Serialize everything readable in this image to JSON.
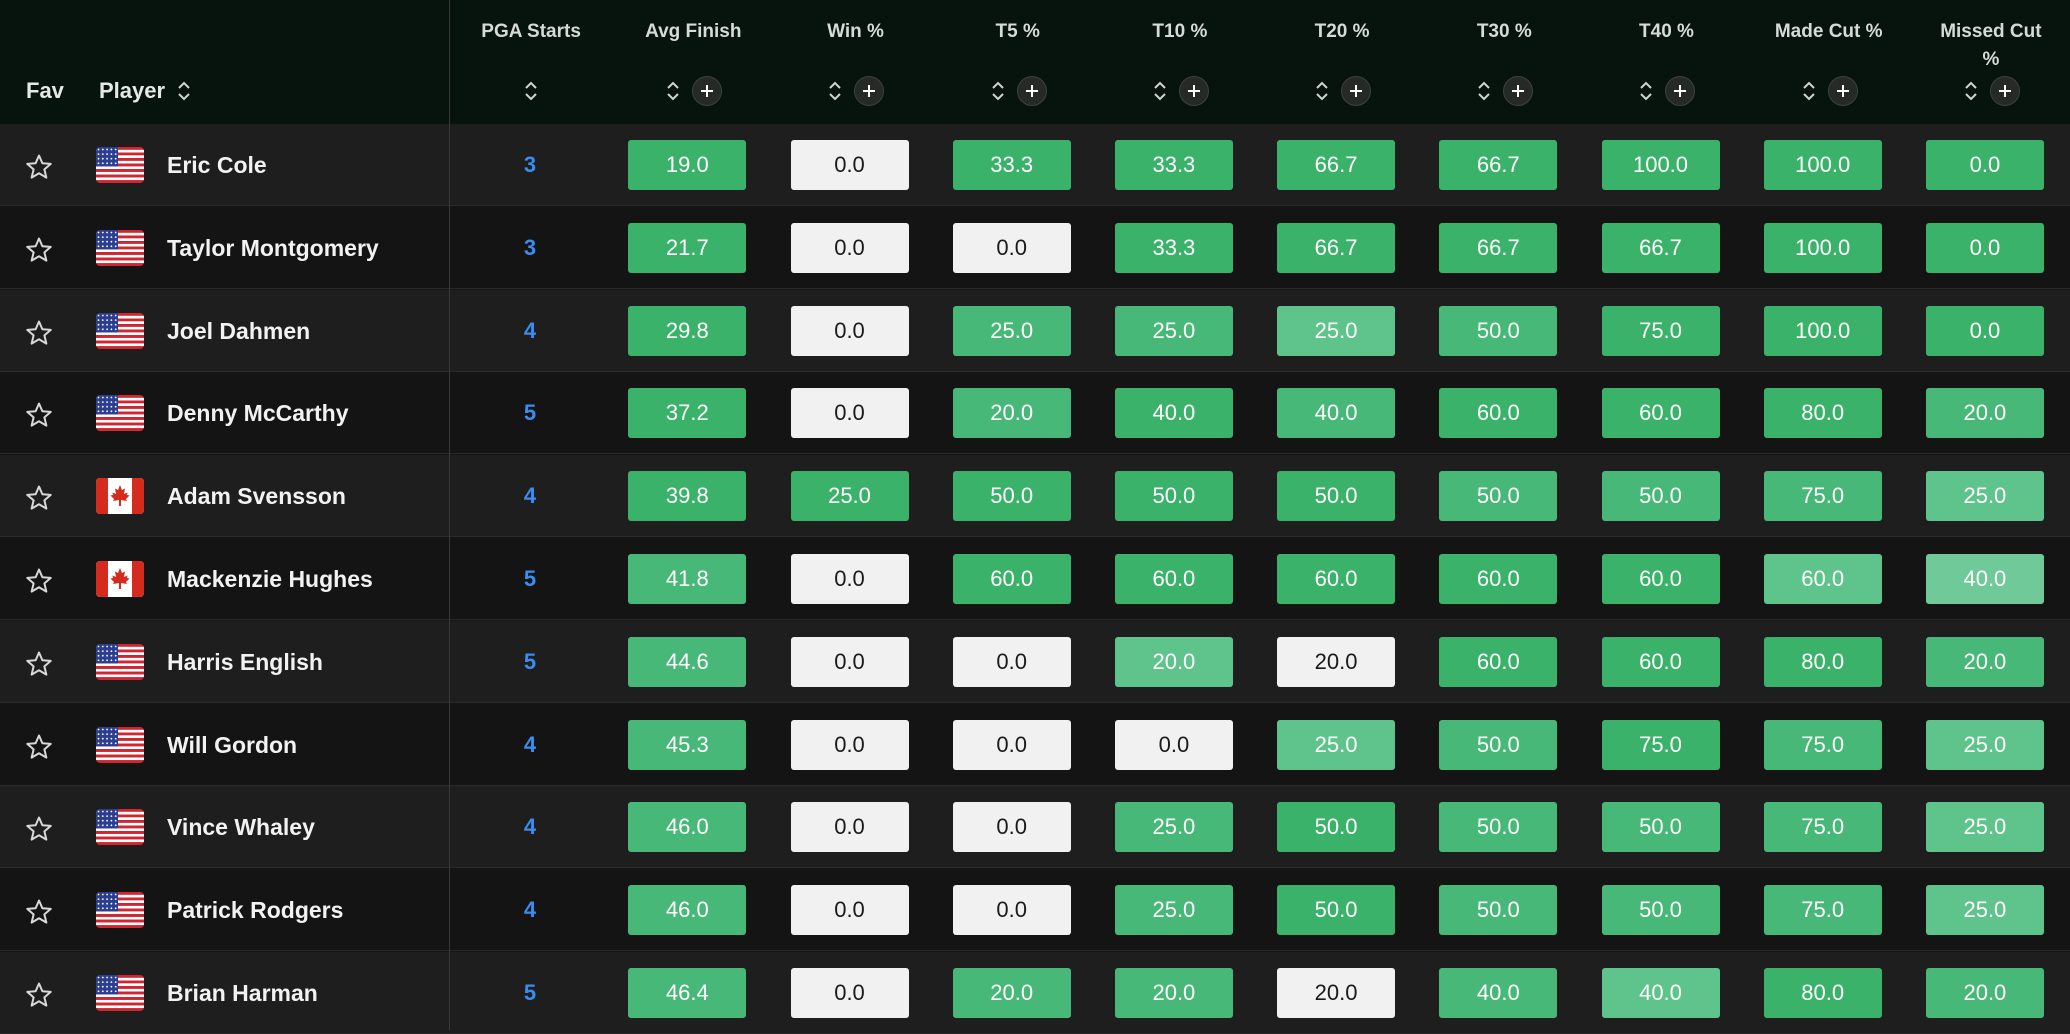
{
  "header": {
    "fav": "Fav",
    "player": "Player",
    "columns": [
      {
        "title": "PGA Starts",
        "plus": false
      },
      {
        "title": "Avg Finish",
        "plus": true
      },
      {
        "title": "Win %",
        "plus": true
      },
      {
        "title": "T5 %",
        "plus": true
      },
      {
        "title": "T10 %",
        "plus": true
      },
      {
        "title": "T20 %",
        "plus": true
      },
      {
        "title": "T30 %",
        "plus": true
      },
      {
        "title": "T40 %",
        "plus": true
      },
      {
        "title": "Made Cut %",
        "plus": true
      },
      {
        "title": "Missed Cut %",
        "plus": true
      }
    ]
  },
  "colors": {
    "header_bg": "#07140d",
    "starts_link": "#3a8df0",
    "green_strong": "#3bb26a",
    "green_mid": "#47b877",
    "green_light": "#5ec48b",
    "green_pale": "#70c998",
    "neutral_cell": "#f1f1f1"
  },
  "rows": [
    {
      "player": "Eric Cole",
      "flag": "us",
      "starts": "3",
      "stats": [
        "19.0",
        "0.0",
        "33.3",
        "33.3",
        "66.7",
        "66.7",
        "100.0",
        "100.0",
        "0.0"
      ],
      "shades": [
        "green1",
        "white",
        "green1",
        "green1",
        "green1",
        "green1",
        "green1",
        "green1",
        "green1"
      ]
    },
    {
      "player": "Taylor Montgomery",
      "flag": "us",
      "starts": "3",
      "stats": [
        "21.7",
        "0.0",
        "0.0",
        "33.3",
        "66.7",
        "66.7",
        "66.7",
        "100.0",
        "0.0"
      ],
      "shades": [
        "green1",
        "white",
        "white",
        "green1",
        "green1",
        "green1",
        "green1",
        "green1",
        "green1"
      ]
    },
    {
      "player": "Joel Dahmen",
      "flag": "us",
      "starts": "4",
      "stats": [
        "29.8",
        "0.0",
        "25.0",
        "25.0",
        "25.0",
        "50.0",
        "75.0",
        "100.0",
        "0.0"
      ],
      "shades": [
        "green1",
        "white",
        "green2",
        "green2",
        "green3",
        "green2",
        "green1",
        "green1",
        "green1"
      ]
    },
    {
      "player": "Denny McCarthy",
      "flag": "us",
      "starts": "5",
      "stats": [
        "37.2",
        "0.0",
        "20.0",
        "40.0",
        "40.0",
        "60.0",
        "60.0",
        "80.0",
        "20.0"
      ],
      "shades": [
        "green1",
        "white",
        "green2",
        "green1",
        "green2",
        "green1",
        "green1",
        "green1",
        "green2"
      ]
    },
    {
      "player": "Adam Svensson",
      "flag": "ca",
      "starts": "4",
      "stats": [
        "39.8",
        "25.0",
        "50.0",
        "50.0",
        "50.0",
        "50.0",
        "50.0",
        "75.0",
        "25.0"
      ],
      "shades": [
        "green1",
        "green1",
        "green1",
        "green1",
        "green1",
        "green2",
        "green2",
        "green2",
        "green3"
      ]
    },
    {
      "player": "Mackenzie Hughes",
      "flag": "ca",
      "starts": "5",
      "stats": [
        "41.8",
        "0.0",
        "60.0",
        "60.0",
        "60.0",
        "60.0",
        "60.0",
        "60.0",
        "40.0"
      ],
      "shades": [
        "green2",
        "white",
        "green1",
        "green1",
        "green1",
        "green1",
        "green1",
        "green3",
        "green4"
      ]
    },
    {
      "player": "Harris English",
      "flag": "us",
      "starts": "5",
      "stats": [
        "44.6",
        "0.0",
        "0.0",
        "20.0",
        "20.0",
        "60.0",
        "60.0",
        "80.0",
        "20.0"
      ],
      "shades": [
        "green2",
        "white",
        "white",
        "green3",
        "white",
        "green1",
        "green1",
        "green1",
        "green2"
      ]
    },
    {
      "player": "Will Gordon",
      "flag": "us",
      "starts": "4",
      "stats": [
        "45.3",
        "0.0",
        "0.0",
        "0.0",
        "25.0",
        "50.0",
        "75.0",
        "75.0",
        "25.0"
      ],
      "shades": [
        "green2",
        "white",
        "white",
        "white",
        "green3",
        "green2",
        "green1",
        "green2",
        "green3"
      ]
    },
    {
      "player": "Vince Whaley",
      "flag": "us",
      "starts": "4",
      "stats": [
        "46.0",
        "0.0",
        "0.0",
        "25.0",
        "50.0",
        "50.0",
        "50.0",
        "75.0",
        "25.0"
      ],
      "shades": [
        "green2",
        "white",
        "white",
        "green2",
        "green1",
        "green2",
        "green2",
        "green2",
        "green3"
      ]
    },
    {
      "player": "Patrick Rodgers",
      "flag": "us",
      "starts": "4",
      "stats": [
        "46.0",
        "0.0",
        "0.0",
        "25.0",
        "50.0",
        "50.0",
        "50.0",
        "75.0",
        "25.0"
      ],
      "shades": [
        "green2",
        "white",
        "white",
        "green2",
        "green1",
        "green2",
        "green2",
        "green2",
        "green3"
      ]
    },
    {
      "player": "Brian Harman",
      "flag": "us",
      "starts": "5",
      "stats": [
        "46.4",
        "0.0",
        "20.0",
        "20.0",
        "20.0",
        "40.0",
        "40.0",
        "80.0",
        "20.0"
      ],
      "shades": [
        "green2",
        "white",
        "green2",
        "green2",
        "white",
        "green2",
        "green3",
        "green1",
        "green2"
      ]
    }
  ]
}
